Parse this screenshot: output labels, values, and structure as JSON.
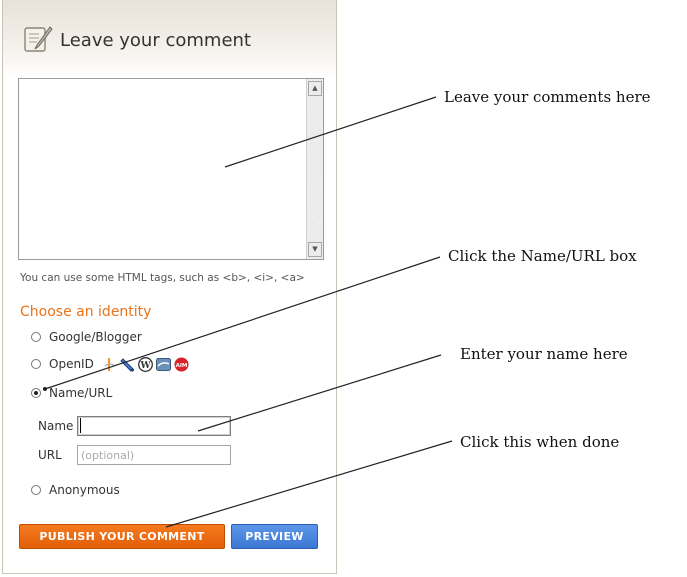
{
  "header": {
    "title": "Leave your comment",
    "icon": "quill-paper-icon"
  },
  "comment": {
    "value": "",
    "html_hint": "You can use some HTML tags, such as <b>, <i>, <a>"
  },
  "identity": {
    "title": "Choose an identity",
    "options": [
      {
        "label": "Google/Blogger",
        "checked": false
      },
      {
        "label": "OpenID",
        "checked": false,
        "icons": [
          "openid-icon",
          "livejournal-icon",
          "wordpress-icon",
          "typepad-icon",
          "aim-icon"
        ]
      },
      {
        "label": "Name/URL",
        "checked": true
      },
      {
        "label": "Anonymous",
        "checked": false
      }
    ],
    "name_label": "Name",
    "name_value": "",
    "url_label": "URL",
    "url_placeholder": "(optional)"
  },
  "buttons": {
    "publish": "PUBLISH YOUR COMMENT",
    "preview": "PREVIEW"
  },
  "callouts": [
    "Leave your comments here",
    "Click the Name/URL box",
    "Enter your name here",
    "Click this when done"
  ],
  "colors": {
    "accent": "#e8731a",
    "publish": "#f06e14",
    "preview": "#4a86e0"
  }
}
